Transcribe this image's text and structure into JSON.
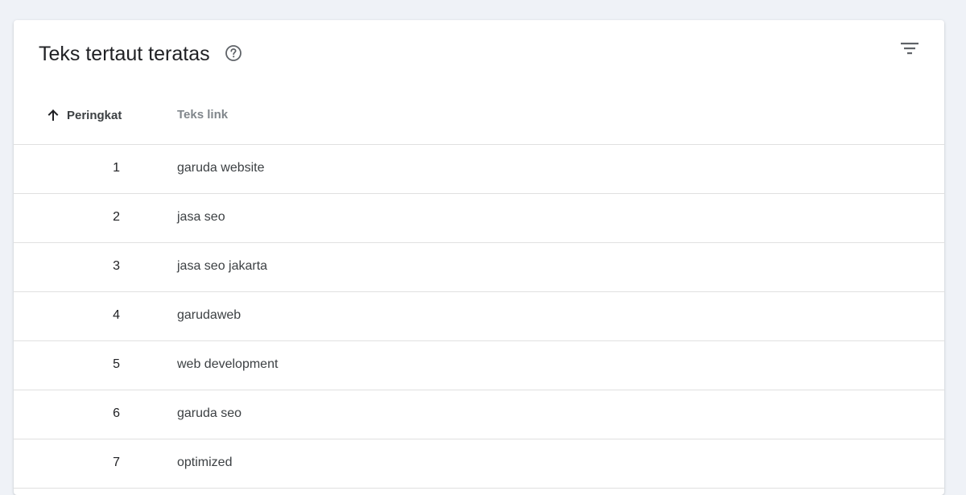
{
  "card": {
    "title": "Teks tertaut teratas",
    "help_icon": "help-circle-icon",
    "filter_icon": "filter-icon"
  },
  "table": {
    "columns": {
      "rank": "Peringkat",
      "text": "Teks link"
    },
    "sort": {
      "column": "rank",
      "direction": "ascending",
      "icon": "arrow-up-icon"
    },
    "rows": [
      {
        "rank": "1",
        "text": "garuda website"
      },
      {
        "rank": "2",
        "text": "jasa seo"
      },
      {
        "rank": "3",
        "text": "jasa seo jakarta"
      },
      {
        "rank": "4",
        "text": "garudaweb"
      },
      {
        "rank": "5",
        "text": "web development"
      },
      {
        "rank": "6",
        "text": "garuda seo"
      },
      {
        "rank": "7",
        "text": "optimized"
      }
    ]
  },
  "colors": {
    "page_background": "#eff2f7",
    "card_background": "#ffffff",
    "divider": "#e0e0e0",
    "muted_header": "#80868b"
  }
}
